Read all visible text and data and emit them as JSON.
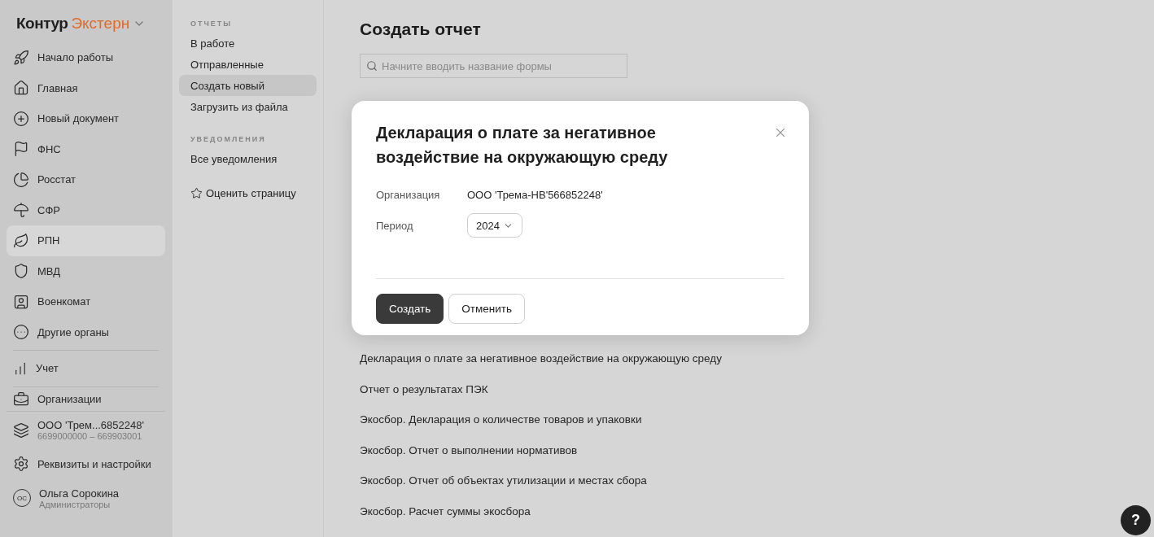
{
  "logo": {
    "brand": "Контур",
    "product": "Экстерн"
  },
  "nav": {
    "main": [
      {
        "label": "Начало работы",
        "selected": false
      },
      {
        "label": "Главная",
        "selected": false
      },
      {
        "label": "Новый документ",
        "selected": false
      },
      {
        "label": "ФНС",
        "selected": false
      },
      {
        "label": "Росстат",
        "selected": false
      },
      {
        "label": "СФР",
        "selected": false
      },
      {
        "label": "РПН",
        "selected": true
      },
      {
        "label": "МВД",
        "selected": false
      },
      {
        "label": "Военкомат",
        "selected": false
      },
      {
        "label": "Другие органы",
        "selected": false
      }
    ],
    "accounting": {
      "label": "Учет"
    },
    "organizations": {
      "label": "Организации"
    }
  },
  "org": {
    "name": "ООО 'Трем...6852248'",
    "codes": "6699000000 – 669903001"
  },
  "settings": {
    "label": "Реквизиты и настройки"
  },
  "user": {
    "initials": "ОС",
    "name": "Ольга Сорокина",
    "role": "Администраторы"
  },
  "subnav": {
    "sections": [
      {
        "title": "ОТЧЕТЫ",
        "items": [
          {
            "label": "В работе",
            "selected": false
          },
          {
            "label": "Отправленные",
            "selected": false
          },
          {
            "label": "Создать новый",
            "selected": true
          },
          {
            "label": "Загрузить из файла",
            "selected": false
          }
        ]
      },
      {
        "title": "УВЕДОМЛЕНИЯ",
        "items": [
          {
            "label": "Все уведомления",
            "selected": false
          }
        ]
      }
    ],
    "rate": "Оценить страницу"
  },
  "main": {
    "title": "Создать отчет",
    "search": {
      "placeholder": "Начните вводить название формы"
    },
    "forms": [
      "Декларация о плате за негативное воздействие на окружающую среду",
      "Отчет о результатах ПЭК",
      "Экосбор. Декларация о количестве товаров и упаковки",
      "Экосбор. Отчет о выполнении нормативов",
      "Экосбор. Отчет об объектах утилизации и местах сбора",
      "Экосбор. Расчет суммы экосбора"
    ]
  },
  "dialog": {
    "title": "Декларация о плате за негативное воздействие на окружающую среду",
    "fields": [
      {
        "kind": "text",
        "label": "Организация",
        "value": "ООО 'Трема-НВ'566852248'"
      },
      {
        "kind": "select",
        "label": "Период",
        "value": "2024"
      }
    ],
    "buttons": [
      {
        "kind": "primary",
        "label": "Создать"
      },
      {
        "kind": "secondary",
        "label": "Отменить"
      }
    ]
  },
  "help": "?"
}
